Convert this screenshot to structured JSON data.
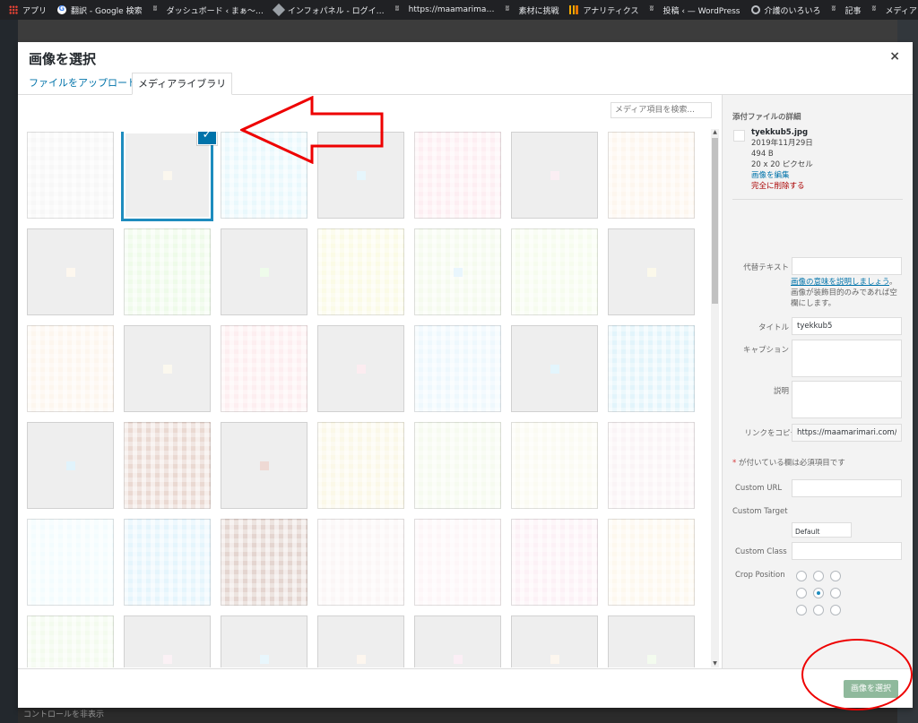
{
  "bookmarks": [
    {
      "label": "アプリ",
      "icon": "apps-icon"
    },
    {
      "label": "翻訳 - Google 検索",
      "icon": "google-icon"
    },
    {
      "label": "ダッシュボード ‹ まぁ〜…",
      "icon": "wordpress-icon"
    },
    {
      "label": "インフォパネル - ログイ…",
      "icon": "diamond-icon"
    },
    {
      "label": "https://maamarima…",
      "icon": "wordpress-icon"
    },
    {
      "label": "素材に挑戦",
      "icon": "wordpress-icon"
    },
    {
      "label": "アナリティクス",
      "icon": "analytics-icon"
    },
    {
      "label": "投稿 ‹ — WordPress",
      "icon": "wordpress-icon"
    },
    {
      "label": "介護のいろいろ",
      "icon": "globe-icon"
    },
    {
      "label": "記事",
      "icon": "wordpress-icon"
    },
    {
      "label": "メディアライブラリ ‹ まぁ…",
      "icon": "wordpress-icon"
    }
  ],
  "modal": {
    "title": "画像を選択",
    "close_icon": "×",
    "tabs": {
      "upload": "ファイルをアップロード",
      "library": "メディアライブラリ"
    }
  },
  "search": {
    "placeholder": "メディア項目を検索..."
  },
  "grid_colors": [
    [
      "#f7f7f7",
      "#eeeeee",
      "#e9f8fc",
      "#eeeeee",
      "#fdeef2",
      "#eeeeee",
      "#fdf6ee"
    ],
    [
      "#eeeeee",
      "#eefbe9",
      "#eeeeee",
      "#fbfbe6",
      "#f5fbee",
      "#f6fcee",
      "#eeeeee"
    ],
    [
      "#fdf6ee",
      "#eeeeee",
      "#fdeef0",
      "#eeeeee",
      "#eef8fd",
      "#eeeeee",
      "#e2f4fb"
    ],
    [
      "#eeeeee",
      "#ead9d2",
      "#eeeeee",
      "#fbf8e8",
      "#f6fbf0",
      "#fbfbf2",
      "#faf4f6"
    ],
    [
      "#f3fcfe",
      "#e5f5fc",
      "#e4d5d0",
      "#fbf6f6",
      "#fdf6f8",
      "#fcf1f6",
      "#fdf8ee"
    ],
    [
      "#f3fbee",
      "#eeeeee",
      "#eeeeee",
      "#eeeeee",
      "#eeeeee",
      "#eeeeee",
      "#eeeeee"
    ]
  ],
  "mini_colors": [
    [
      null,
      "#fbf7ee",
      null,
      "#e6f6fc",
      null,
      "#fbeef3",
      null
    ],
    [
      "#fdf7ee",
      null,
      "#eefbea",
      null,
      "#e9f6fd",
      null,
      "#fbf8ea"
    ],
    [
      null,
      "#fbf8ee",
      null,
      "#fcecf0",
      null,
      "#e3f5fc",
      null
    ],
    [
      "#e1f3fb",
      null,
      "#eed9d4",
      null,
      null,
      null,
      null
    ],
    [
      null,
      null,
      null,
      null,
      null,
      null,
      null
    ],
    [
      null,
      "#fbf1f5",
      "#e8f6fc",
      "#fdf6ee",
      "#fbeef5",
      "#fcf6ee",
      "#f3fbee"
    ]
  ],
  "sidebar": {
    "heading": "添付ファイルの詳細",
    "filename": "tyekkub5.jpg",
    "date": "2019年11月29日",
    "size": "494 B",
    "dimensions": "20 x 20 ピクセル",
    "edit_link": "画像を編集",
    "delete_link": "完全に削除する",
    "alt_label": "代替テキスト",
    "alt_value": "",
    "alt_help_link": "画像の意味を説明しましょう",
    "alt_help_text": "。画像が装飾目的のみであれば空欄にします。",
    "title_label": "タイトル",
    "title_value": "tyekkub5",
    "caption_label": "キャプション",
    "description_label": "説明",
    "link_label": "リンクをコピー",
    "link_value": "https://maamarimari.com/mu",
    "required_star": "*",
    "required_text": " が付いている欄は必須項目です",
    "custom_url_label": "Custom URL",
    "custom_target_label": "Custom Target",
    "custom_target_value": "Default",
    "custom_class_label": "Custom Class",
    "crop_label": "Crop Position"
  },
  "toolbar": {
    "select_button": "画像を選択"
  },
  "bottom_text": "コントロールを非表示",
  "colors": {
    "accent": "#0073aa",
    "selection": "#1e8cbe",
    "annotation": "#e00000",
    "button": "#8fb99c"
  }
}
